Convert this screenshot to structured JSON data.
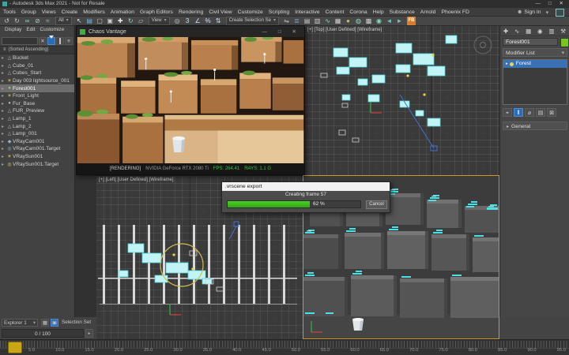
{
  "icons": {
    "expand": "▸",
    "dropdown": "▾",
    "close": "✕",
    "min": "—",
    "max": "□",
    "person": "☻",
    "list": "≡",
    "spinner": "▸",
    "grid": "▦",
    "cube": "▣",
    "sort": "≡",
    "win_controls": "—  □  ✕"
  },
  "window": {
    "title": "- Autodesk 3ds Max 2021 - Not for Resale"
  },
  "menu": {
    "items": [
      "Tools",
      "Group",
      "Views",
      "Create",
      "Modifiers",
      "Animation",
      "Graph Editors",
      "Rendering",
      "Civil View",
      "Customize",
      "Scripting",
      "Interactive",
      "Content",
      "Corona",
      "Help",
      "Substance",
      "Arnold",
      "Phoenix FD"
    ],
    "sign_in": "Sign In"
  },
  "toolbar": {
    "group1": [
      {
        "name": "undo-icon",
        "glyph": "↺",
        "color": "#c9c9c9"
      },
      {
        "name": "redo-icon",
        "glyph": "↻",
        "color": "#c9c9c9"
      },
      {
        "name": "select-and-link-icon",
        "glyph": "∞",
        "color": "#9dd3c8"
      },
      {
        "name": "unlink-selection-icon",
        "glyph": "⊘",
        "color": "#9dd3c8"
      },
      {
        "name": "bind-to-space-warp-icon",
        "glyph": "≈",
        "color": "#9dd3c8"
      }
    ],
    "filter_value": "All",
    "group2": [
      {
        "name": "select-object-icon",
        "glyph": "↖",
        "color": "#e8e8e8"
      },
      {
        "name": "select-by-name-icon",
        "glyph": "▤",
        "color": "#76b8e0"
      },
      {
        "name": "rectangular-selection-region-icon",
        "glyph": "▢",
        "color": "#cfcfcf"
      },
      {
        "name": "window-crossing-icon",
        "glyph": "▣",
        "color": "#cfcfcf"
      },
      {
        "name": "select-and-move-icon",
        "glyph": "✚",
        "color": "#e8e8e8"
      },
      {
        "name": "select-and-rotate-icon",
        "glyph": "↻",
        "color": "#8fd8c8"
      },
      {
        "name": "select-and-scale-icon",
        "glyph": "▱",
        "color": "#cfcfcf"
      }
    ],
    "coord_value": "View",
    "group3": [
      {
        "name": "use-pivot-center-icon",
        "glyph": "◎",
        "color": "#cfcfcf"
      },
      {
        "name": "snaps-toggle-icon",
        "glyph": "3",
        "color": "#cfe0ff"
      },
      {
        "name": "angle-snap-icon",
        "glyph": "∠",
        "color": "#cfe0ff"
      },
      {
        "name": "percent-snap-icon",
        "glyph": "%",
        "color": "#cfe0ff"
      },
      {
        "name": "spinner-snap-icon",
        "glyph": "⇅",
        "color": "#cfe0ff"
      }
    ],
    "sel_set_value": "Create Selection Se",
    "group4": [
      {
        "name": "mirror-icon",
        "glyph": "⇋",
        "color": "#cfcfcf"
      },
      {
        "name": "align-icon",
        "glyph": "≣",
        "color": "#76b8e0"
      },
      {
        "name": "layer-explorer-icon",
        "glyph": "▤",
        "color": "#cfcfcf"
      },
      {
        "name": "toggle-ribbon-icon",
        "glyph": "▥",
        "color": "#cfcfcf"
      },
      {
        "name": "curve-editor-icon",
        "glyph": "∿",
        "color": "#8fd8c8"
      },
      {
        "name": "schematic-view-icon",
        "glyph": "▦",
        "color": "#cfcfcf"
      },
      {
        "name": "material-editor-icon",
        "glyph": "●",
        "color": "#d8b45a"
      },
      {
        "name": "render-setup-icon",
        "glyph": "◍",
        "color": "#8fd8c8"
      },
      {
        "name": "rendered-frame-window-icon",
        "glyph": "▩",
        "color": "#cfcfcf"
      },
      {
        "name": "render-production-icon",
        "glyph": "◉",
        "color": "#8fd8c8"
      },
      {
        "name": "render-prev-icon",
        "glyph": "◄",
        "color": "#5bc8b4"
      },
      {
        "name": "render-next-icon",
        "glyph": "►",
        "color": "#5bc8b4"
      }
    ],
    "fb_label": "FB"
  },
  "explorer": {
    "menus": [
      "Display",
      "Edit",
      "Customize"
    ],
    "sort_header": "(Sorted Ascending)",
    "items": [
      {
        "label": "Bucket",
        "glyph": "△",
        "color": "#b8b8b8"
      },
      {
        "label": "Cube_01",
        "glyph": "△",
        "color": "#b8b8b8"
      },
      {
        "label": "Cubes_Start",
        "glyph": "△",
        "color": "#b8b8b8"
      },
      {
        "label": "Day 003 lightsource_001",
        "glyph": "☀",
        "color": "#e0d060"
      },
      {
        "label": "Forest001",
        "glyph": "●",
        "color": "#9fcf70",
        "selected": true
      },
      {
        "label": "Front_Light",
        "glyph": "☀",
        "color": "#e0d060"
      },
      {
        "label": "Fur_Base",
        "glyph": "●",
        "color": "#b8b8b8"
      },
      {
        "label": "FUR_Preview",
        "glyph": "△",
        "color": "#b8b8b8"
      },
      {
        "label": "Lamp_1",
        "glyph": "△",
        "color": "#b8b8b8"
      },
      {
        "label": "Lamp_2",
        "glyph": "△",
        "color": "#b8b8b8"
      },
      {
        "label": "Lamp_001",
        "glyph": "△",
        "color": "#b8b8b8"
      },
      {
        "label": "VRayCam001",
        "glyph": "◆",
        "color": "#8fb4d8"
      },
      {
        "label": "VRayCam001.Target",
        "glyph": "◎",
        "color": "#8fb4d8"
      },
      {
        "label": "VRaySun001",
        "glyph": "☀",
        "color": "#e0d060"
      },
      {
        "label": "VRaySun001.Target",
        "glyph": "◎",
        "color": "#e0d060"
      }
    ]
  },
  "vantage": {
    "title": "Chaos Vantage",
    "status_state": "[RENDERING]",
    "status_gpu": "NVIDIA GeForce RTX 2080 Ti",
    "fps": "FPS: 264.41",
    "rays": "RAYS: 1.1 G"
  },
  "viewports": {
    "top_label": "[+] [Top] [User Defined] [Wireframe]",
    "left_label": "[+] [Left] [User Defined] [Wireframe]"
  },
  "dialog": {
    "title": ".vrscene export",
    "message": "Creating frame 57",
    "percent": 62,
    "percent_text": "62 %",
    "cancel": "Cancel"
  },
  "panel": {
    "tabs": [
      "✚",
      "∿",
      "▦",
      "◉",
      "▥",
      "⚒"
    ],
    "object_name": "Forest001",
    "modifier_list": "Modifier List",
    "stack_item": "Forest",
    "tools": [
      {
        "glyph": "⌖"
      },
      {
        "glyph": "‖",
        "selected": true
      },
      {
        "glyph": "⌀"
      },
      {
        "glyph": "▤"
      },
      {
        "glyph": "⊠"
      }
    ],
    "rollout": "General"
  },
  "bottom": {
    "explorer_selector": "Explorer 1",
    "selection_set": "Selection Set",
    "frame": "0 / 100"
  },
  "timeline": {
    "labels": [
      "5.0",
      "10.0",
      "15.0",
      "20.0",
      "25.0",
      "30.0",
      "35.0",
      "40.0",
      "45.0",
      "50.0",
      "55.0",
      "60.0",
      "65.0",
      "70.0",
      "75.0",
      "80.0",
      "85.0",
      "90.0",
      "95.0"
    ]
  }
}
